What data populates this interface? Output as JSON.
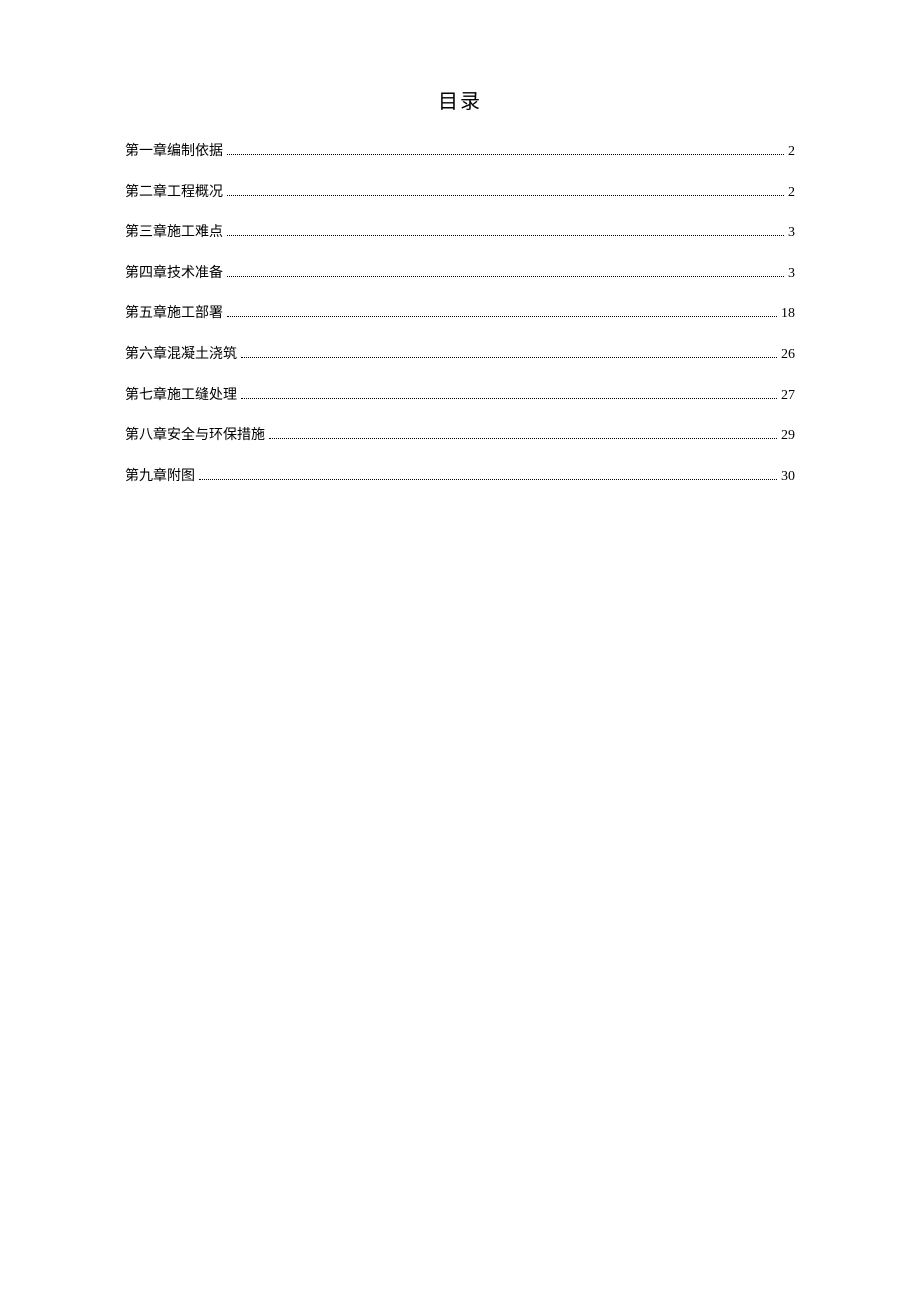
{
  "title": "目录",
  "toc": [
    {
      "label": "第一章编制依据",
      "page": "2"
    },
    {
      "label": "第二章工程概况",
      "page": "2"
    },
    {
      "label": "第三章施工难点",
      "page": "3"
    },
    {
      "label": "第四章技术准备",
      "page": "3"
    },
    {
      "label": "第五章施工部署",
      "page": "18"
    },
    {
      "label": "第六章混凝土浇筑",
      "page": "26"
    },
    {
      "label": "第七章施工缝处理",
      "page": "27"
    },
    {
      "label": "第八章安全与环保措施",
      "page": "29"
    },
    {
      "label": "第九章附图",
      "page": "30"
    }
  ]
}
